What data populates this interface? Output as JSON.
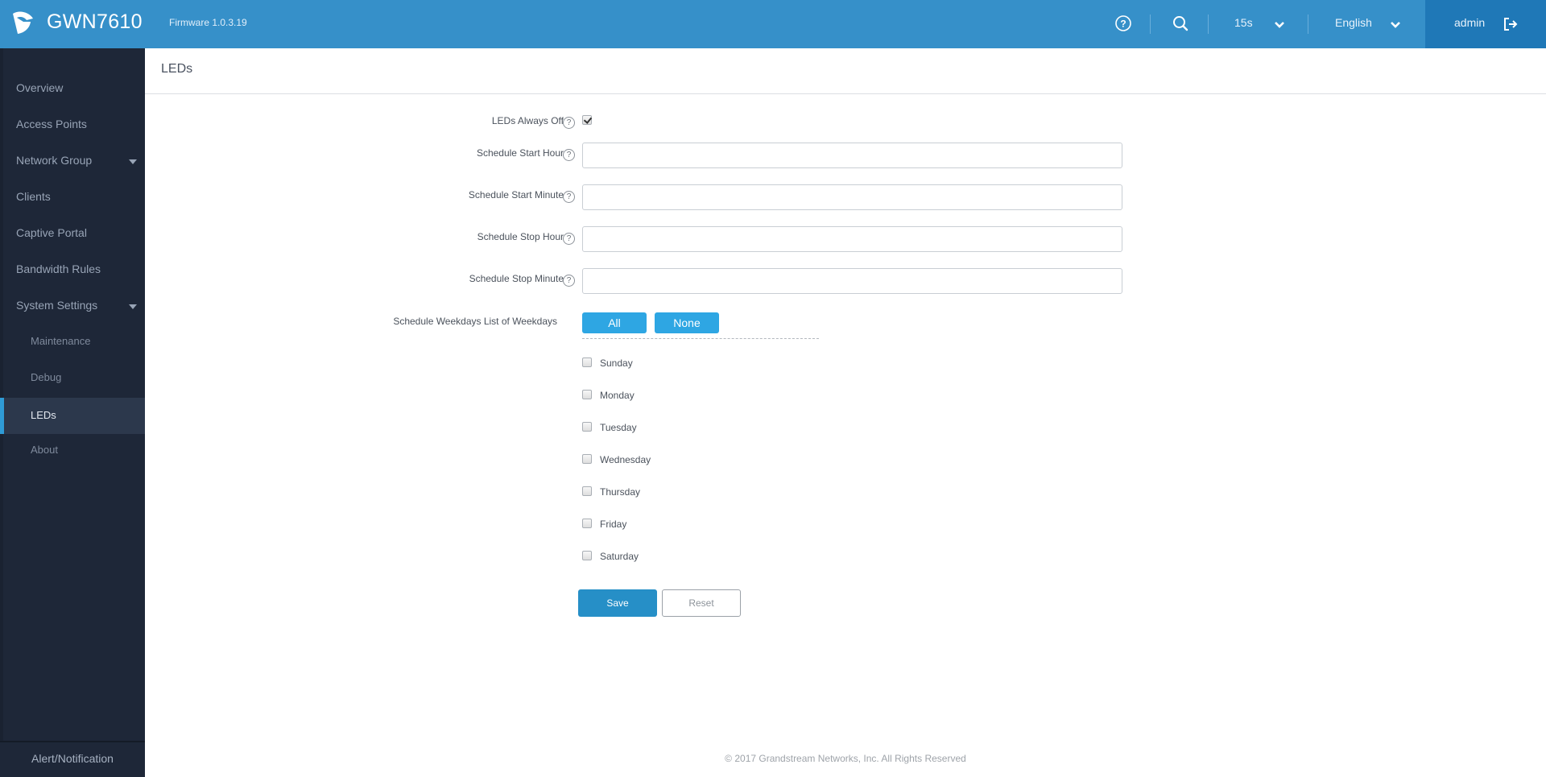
{
  "header": {
    "product": "GWN7610",
    "firmware": "Firmware 1.0.3.19",
    "refresh_interval": "15s",
    "language": "English",
    "user": "admin",
    "brand_color": "#3690c9",
    "user_area_color": "#1f78b7"
  },
  "sidebar": {
    "items": [
      {
        "label": "Overview"
      },
      {
        "label": "Access Points"
      },
      {
        "label": "Network Group",
        "expandable": true
      },
      {
        "label": "Clients"
      },
      {
        "label": "Captive Portal"
      },
      {
        "label": "Bandwidth Rules"
      },
      {
        "label": "System Settings",
        "expandable": true
      },
      {
        "label": "Maintenance",
        "sub": true
      },
      {
        "label": "Debug",
        "sub": true
      },
      {
        "label": "LEDs",
        "sub": true,
        "active": true
      },
      {
        "label": "About",
        "sub": true
      }
    ],
    "footer_label": "Alert/Notification"
  },
  "page": {
    "title": "LEDs",
    "form": {
      "leds_always_off": {
        "label": "LEDs Always Off",
        "checked": true
      },
      "start_hour": {
        "label": "Schedule Start Hour",
        "value": ""
      },
      "start_minute": {
        "label": "Schedule Start Minute",
        "value": ""
      },
      "stop_hour": {
        "label": "Schedule Stop Hour",
        "value": ""
      },
      "stop_minute": {
        "label": "Schedule Stop Minute",
        "value": ""
      },
      "weekdays": {
        "label": "Schedule Weekdays List of Weekdays",
        "all_label": "All",
        "none_label": "None",
        "days": [
          {
            "label": "Sunday",
            "checked": false
          },
          {
            "label": "Monday",
            "checked": false
          },
          {
            "label": "Tuesday",
            "checked": false
          },
          {
            "label": "Wednesday",
            "checked": false
          },
          {
            "label": "Thursday",
            "checked": false
          },
          {
            "label": "Friday",
            "checked": false
          },
          {
            "label": "Saturday",
            "checked": false
          }
        ]
      },
      "help_glyph": "?"
    },
    "save_label": "Save",
    "reset_label": "Reset"
  },
  "footer": {
    "copyright": "© 2017 Grandstream Networks, Inc. All Rights Reserved"
  }
}
